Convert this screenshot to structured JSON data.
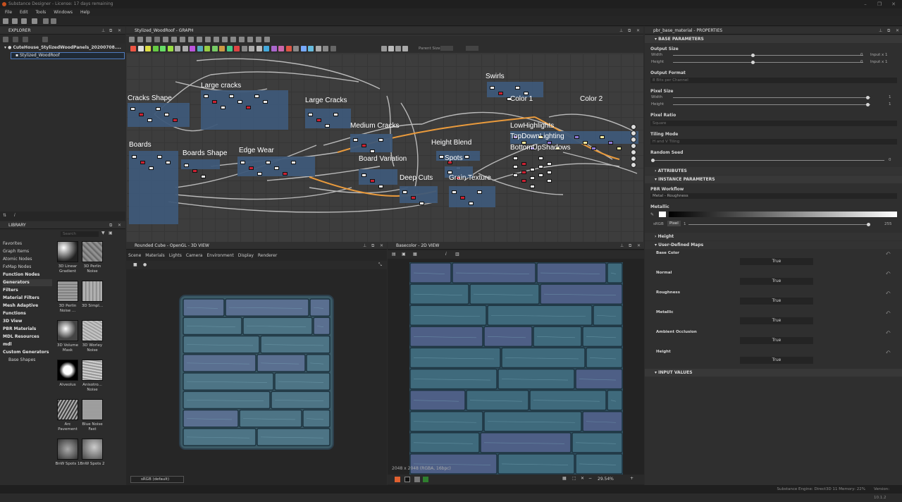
{
  "window": {
    "title": "Substance Designer - License: 17 days remaining"
  },
  "menu": [
    "File",
    "Edit",
    "Tools",
    "Windows",
    "Help"
  ],
  "explorer": {
    "title": "EXPLORER",
    "package": "CuteHouse_StylizedWoodPanels_20200708....",
    "graph": "Stylized_WoodRoof"
  },
  "library": {
    "title": "LIBRARY",
    "search_placeholder": "Search",
    "categories": [
      {
        "label": "Favorites",
        "bold": false
      },
      {
        "label": "Graph Items",
        "bold": false
      },
      {
        "label": "Atomic Nodes",
        "bold": false
      },
      {
        "label": "FxMap Nodes",
        "bold": false
      },
      {
        "label": "Function Nodes",
        "bold": true
      },
      {
        "label": "Generators",
        "bold": true
      },
      {
        "label": "Filters",
        "bold": true
      },
      {
        "label": "Material Filters",
        "bold": true
      },
      {
        "label": "Mesh Adaptive",
        "bold": true
      },
      {
        "label": "Functions",
        "bold": true
      },
      {
        "label": "3D View",
        "bold": true
      },
      {
        "label": "PBR Materials",
        "bold": true
      },
      {
        "label": "MDL Resources",
        "bold": true
      },
      {
        "label": "mdl",
        "bold": true
      },
      {
        "label": "Custom Generators",
        "bold": true
      },
      {
        "label": "Base Shapes",
        "bold": false
      }
    ],
    "items": [
      {
        "label": "3D Linear Gradient"
      },
      {
        "label": "3D Perlin Noise"
      },
      {
        "label": "3D Perlin Noise ..."
      },
      {
        "label": "3D Simpl..."
      },
      {
        "label": "3D Volume Mask"
      },
      {
        "label": "3D Worley Noise"
      },
      {
        "label": "Alveolus"
      },
      {
        "label": "Anisotro... Noise"
      },
      {
        "label": "Arc Pavement"
      },
      {
        "label": "Blue Noise Fast"
      },
      {
        "label": "BnW Spots 1"
      },
      {
        "label": "BnW Spots 2"
      }
    ]
  },
  "graph": {
    "title": "Stylized_WoodRoof - GRAPH",
    "parent_size_label": "Parent Size:",
    "frames": [
      "Cracks Shape",
      "Large cracks",
      "Large Cracks",
      "Medium Cracks",
      "Swirls",
      "Color 1",
      "Color 2",
      "Boards",
      "Boards Shape",
      "Edge Wear",
      "Board Variation",
      "Height Blend",
      "Spots",
      "Deep Cuts",
      "Grain Texture",
      "LowHighlights",
      "TopDownLighting",
      "BottomUpShadows"
    ]
  },
  "view3d": {
    "title": "Rounded Cube - OpenGL - 3D VIEW",
    "menu": [
      "Scene",
      "Materials",
      "Lights",
      "Camera",
      "Environment",
      "Display",
      "Renderer"
    ],
    "colorspace": "sRGB (default)"
  },
  "view2d": {
    "title": "Basecolor - 2D VIEW",
    "info": "2048 x 2048 (RGBA, 16bpc)",
    "zoom": "29.54%"
  },
  "properties": {
    "title": "pbr_base_material - PROPERTIES",
    "base_parameters": "BASE PARAMETERS",
    "output_size": "Output Size",
    "width": "Width",
    "height": "Height",
    "width_value": "0",
    "height_value": "0",
    "input_x1": "Input x 1",
    "output_format": "Output Format",
    "output_format_value": "8 Bits per Channel",
    "pixel_size": "Pixel Size",
    "pixel_width_value": "1",
    "pixel_height_value": "1",
    "pixel_ratio": "Pixel Ratio",
    "pixel_ratio_value": "Square",
    "tiling_mode": "Tiling Mode",
    "tiling_mode_value": "H and V Tiling",
    "random_seed": "Random Seed",
    "random_seed_value": "0",
    "attributes": "ATTRIBUTES",
    "instance_parameters": "INSTANCE PARAMETERS",
    "pbr_workflow": "PBR Workflow",
    "pbr_workflow_value": "Metal - Roughness",
    "metallic": "Metallic",
    "srgb": "sRGB",
    "pixel": "Pixel",
    "metallic_min": "1",
    "metallic_max": "255",
    "height_group": "Height",
    "user_maps": "User-Defined Maps",
    "maps": [
      {
        "name": "Base Color",
        "value": "True"
      },
      {
        "name": "Normal",
        "value": "True"
      },
      {
        "name": "Roughness",
        "value": "True"
      },
      {
        "name": "Metallic",
        "value": "True"
      },
      {
        "name": "Ambient Occlusion",
        "value": "True"
      },
      {
        "name": "Height",
        "value": "True"
      }
    ],
    "input_values": "INPUT VALUES"
  },
  "status": {
    "text": "Substance Engine: Direct3D 11  Memory: 22%",
    "version": "Version: 10.1.2"
  }
}
